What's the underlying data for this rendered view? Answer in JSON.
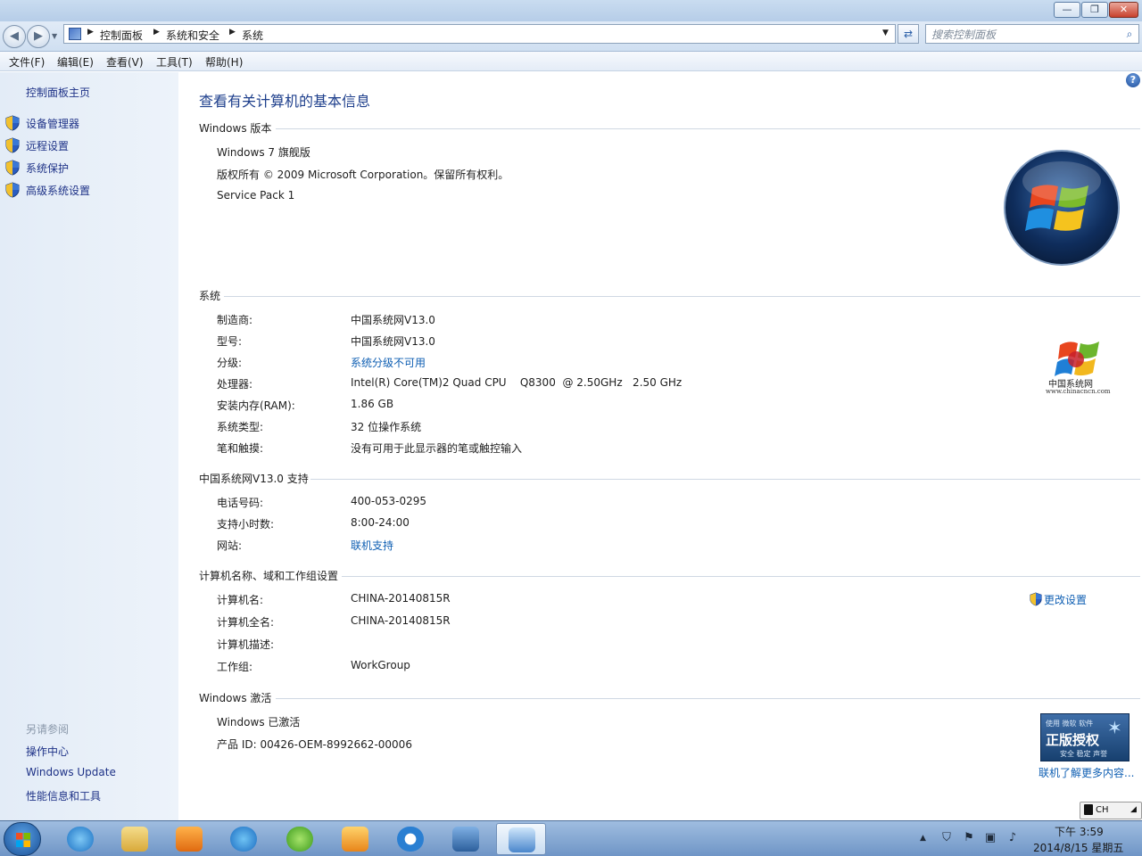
{
  "titlebar": {
    "min_glyph": "—",
    "max_glyph": "❐",
    "close_glyph": "✕"
  },
  "navbar": {
    "back_glyph": "◀",
    "forward_glyph": "▶",
    "breadcrumb": [
      "控制面板",
      "系统和安全",
      "系统"
    ],
    "search_placeholder": "搜索控制面板",
    "refresh_glyph": "⇄"
  },
  "menu": [
    "文件(F)",
    "编辑(E)",
    "查看(V)",
    "工具(T)",
    "帮助(H)"
  ],
  "sidebar": {
    "home": "控制面板主页",
    "tasks": [
      "设备管理器",
      "远程设置",
      "系统保护",
      "高级系统设置"
    ],
    "see_also_header": "另请参阅",
    "see_also": [
      "操作中心",
      "Windows Update",
      "性能信息和工具"
    ]
  },
  "main": {
    "title": "查看有关计算机的基本信息",
    "edition": {
      "header": "Windows 版本",
      "name": "Windows 7 旗舰版",
      "copyright": "版权所有 © 2009 Microsoft Corporation。保留所有权利。",
      "service_pack": "Service Pack 1"
    },
    "system": {
      "header": "系统",
      "rows": [
        {
          "label": "制造商:",
          "value": "中国系统网V13.0"
        },
        {
          "label": "型号:",
          "value": "中国系统网V13.0"
        },
        {
          "label": "分级:",
          "value": "系统分级不可用"
        },
        {
          "label": "处理器:",
          "value": "Intel(R) Core(TM)2 Quad CPU    Q8300  @ 2.50GHz   2.50 GHz"
        },
        {
          "label": "安装内存(RAM):",
          "value": "1.86 GB"
        },
        {
          "label": "系统类型:",
          "value": "32 位操作系统"
        },
        {
          "label": "笔和触摸:",
          "value": "没有可用于此显示器的笔或触控输入"
        }
      ],
      "oem_logo_text": "中国系统网",
      "oem_logo_url": "www.chinacncn.com"
    },
    "support": {
      "header": "中国系统网V13.0 支持",
      "rows": [
        {
          "label": "电话号码:",
          "value": "400-053-0295"
        },
        {
          "label": "支持小时数:",
          "value": "8:00-24:00"
        },
        {
          "label": "网站:",
          "value": "联机支持"
        }
      ]
    },
    "computer_name": {
      "header": "计算机名称、域和工作组设置",
      "change_link": "更改设置",
      "rows": [
        {
          "label": "计算机名:",
          "value": "CHINA-20140815R"
        },
        {
          "label": "计算机全名:",
          "value": "CHINA-20140815R"
        },
        {
          "label": "计算机描述:",
          "value": ""
        },
        {
          "label": "工作组:",
          "value": "WorkGroup"
        }
      ]
    },
    "activation": {
      "header": "Windows 激活",
      "status": "Windows 已激活",
      "product_id": "产品 ID: 00426-OEM-8992662-00006",
      "badge_line1": "使用 微软 软件",
      "badge_line2": "正版授权",
      "badge_line3": "安全 稳定 声誉",
      "learn_more": "联机了解更多内容..."
    }
  },
  "taskbar": {
    "apps": [
      "internet-explorer",
      "file-explorer",
      "media-player",
      "browser",
      "update-manager",
      "game",
      "media-center",
      "video-editor",
      "control-panel"
    ],
    "clock_time": "下午 3:59",
    "clock_date": "2014/8/15 星期五",
    "language": "CH"
  },
  "colors": {
    "accent": "#1e3f8c",
    "link": "#0f5fb3",
    "sidebar_bg": "#e3ecf7"
  }
}
